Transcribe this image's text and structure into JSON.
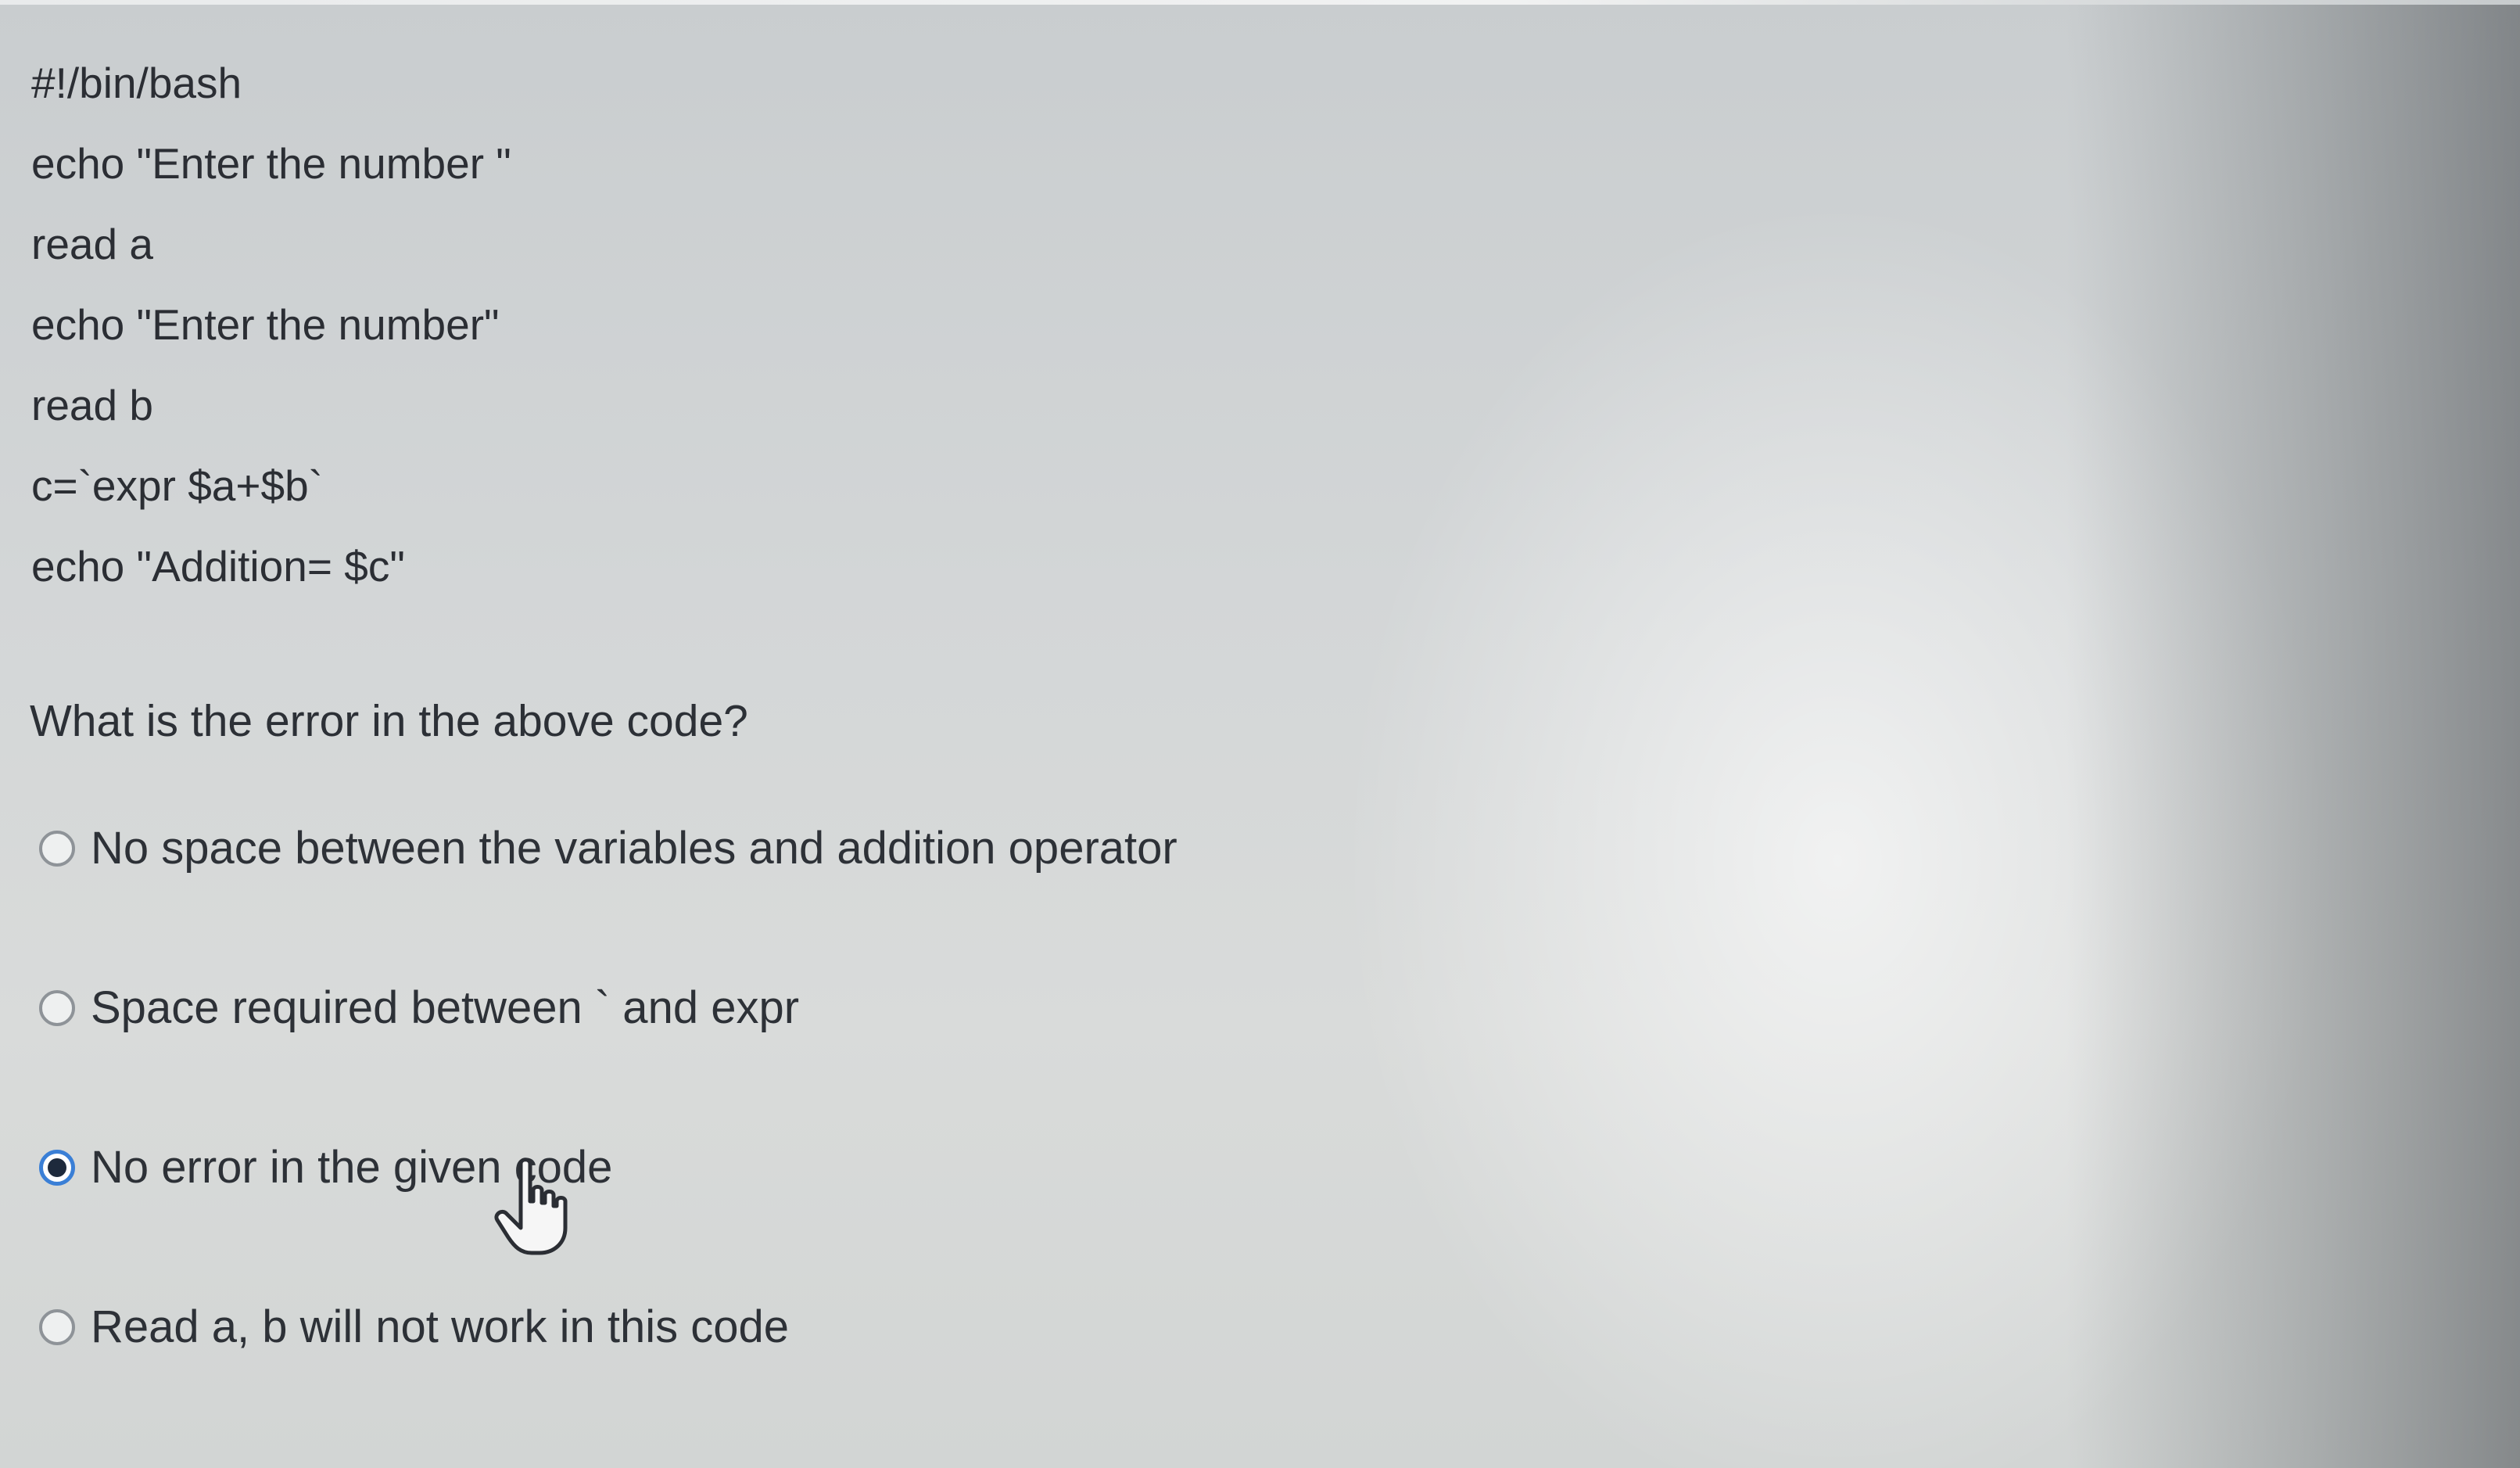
{
  "code": {
    "lines": [
      "#!/bin/bash",
      "echo \"Enter the number \"",
      "read a",
      "echo \"Enter the number\"",
      "read b",
      "c=`expr $a+$b`",
      "echo \"Addition= $c\""
    ]
  },
  "question": {
    "text": "What is the error in the above code?"
  },
  "options": [
    {
      "label": "No space between the variables and addition operator",
      "selected": false
    },
    {
      "label": "Space required between ` and expr",
      "selected": false
    },
    {
      "label": "No error in the given code",
      "selected": true
    },
    {
      "label": "Read a, b will not work in this code",
      "selected": false
    }
  ],
  "colors": {
    "selected_radio_border": "#3a7fd6",
    "selected_radio_dot": "#1e2a3c",
    "text": "#2d3137"
  },
  "icons": {
    "cursor": "hand-pointer-icon"
  }
}
